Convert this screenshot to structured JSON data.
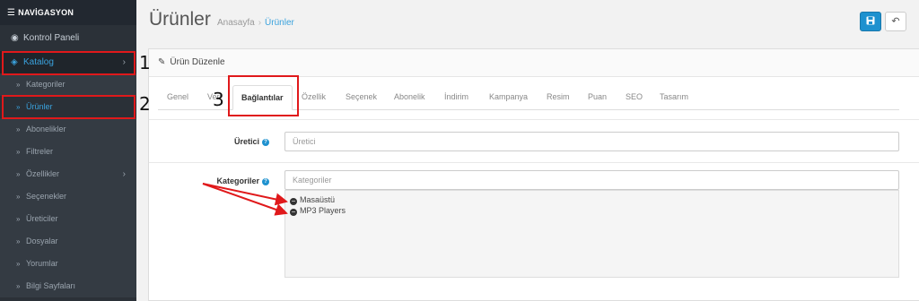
{
  "sidebar": {
    "header": "NAVİGASYON",
    "dashboard": "Kontrol Paneli",
    "catalog": "Katalog",
    "sub_items": [
      "Kategoriler",
      "Ürünler",
      "Abonelikler",
      "Filtreler",
      "Özellikler",
      "Seçenekler",
      "Üreticiler",
      "Dosyalar",
      "Yorumlar",
      "Bilgi Sayfaları"
    ],
    "arrow": "›"
  },
  "header": {
    "title": "Ürünler",
    "breadcrumb": [
      "Anasayfa",
      "Ürünler"
    ],
    "breadcrumb_sep": "›"
  },
  "panel": {
    "title": "Ürün Düzenle",
    "tabs": [
      "Genel",
      "Veri",
      "Bağlantılar",
      "Özellik",
      "Seçenek",
      "Abonelik",
      "İndirim",
      "Kampanya",
      "Resim",
      "Puan",
      "SEO",
      "Tasarım"
    ],
    "manufacturer_label": "Üretici",
    "manufacturer_placeholder": "Üretici",
    "categories_label": "Kategoriler",
    "categories_placeholder": "Kategoriler",
    "selected_categories": [
      "Masaüstü",
      "MP3 Players"
    ]
  },
  "annotations": [
    "1",
    "2",
    "3"
  ],
  "colors": {
    "accent": "#1e91cf",
    "annotation": "#e0191b"
  }
}
